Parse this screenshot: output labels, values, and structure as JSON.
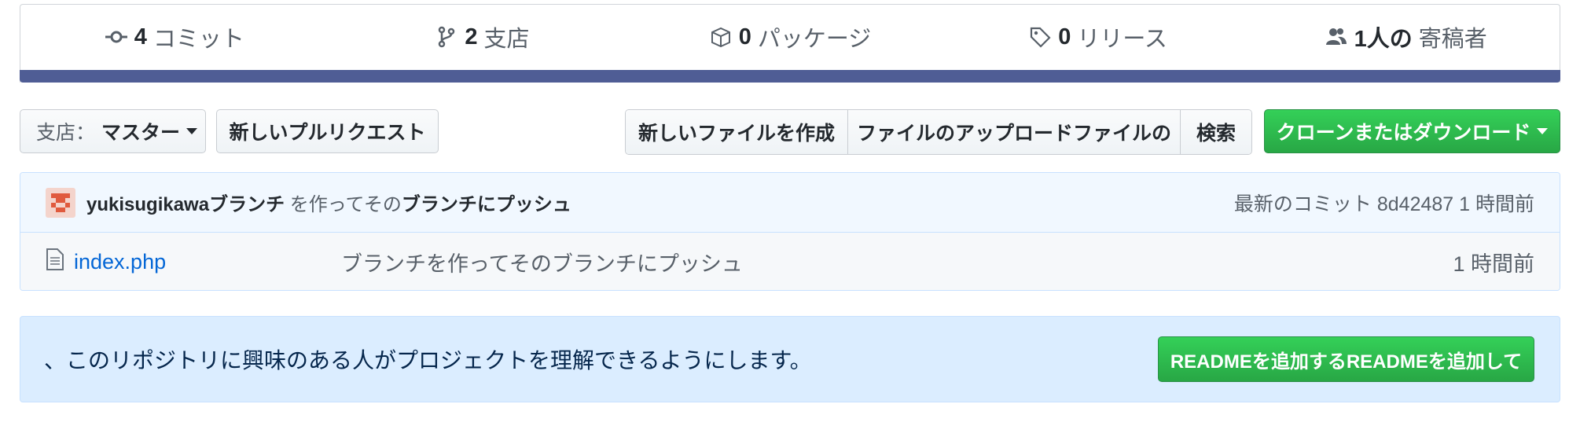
{
  "summary": {
    "commits": {
      "count": "4",
      "label": "コミット",
      "icon": "commit-icon"
    },
    "branches": {
      "count": "2",
      "label": "支店",
      "icon": "branch-icon"
    },
    "packages": {
      "count": "0",
      "label": "パッケージ",
      "icon": "package-icon"
    },
    "releases": {
      "count": "0",
      "label": "リリース",
      "icon": "tag-icon"
    },
    "contributors": {
      "count": "1人の",
      "label": "寄稿者",
      "icon": "people-icon"
    },
    "language_bar_color": "#4f5d95"
  },
  "toolbar": {
    "branch_label": "支店：",
    "branch_value": "マスター",
    "new_pr": "新しいプルリクエスト",
    "create_file": "新しいファイルを作成",
    "upload_files": "ファイルのアップロードファイルの",
    "find_file": "検索",
    "clone": "クローンまたはダウンロード",
    "clone_color": "#28a745"
  },
  "commit": {
    "author": "yukisugikawaブランチ",
    "message_mid": " を作ってその",
    "message_end": "ブランチにプッシュ",
    "latest_label": "最新のコミット",
    "sha": "8d42487",
    "age": "1 時間前"
  },
  "files": [
    {
      "name": "index.php",
      "message": "ブランチを作ってそのブランチにプッシュ",
      "age": "1 時間前"
    }
  ],
  "readme": {
    "text": "、このリポジトリに興味のある人がプロジェクトを理解できるようにします。",
    "button": "READMEを追加するREADMEを追加して"
  }
}
